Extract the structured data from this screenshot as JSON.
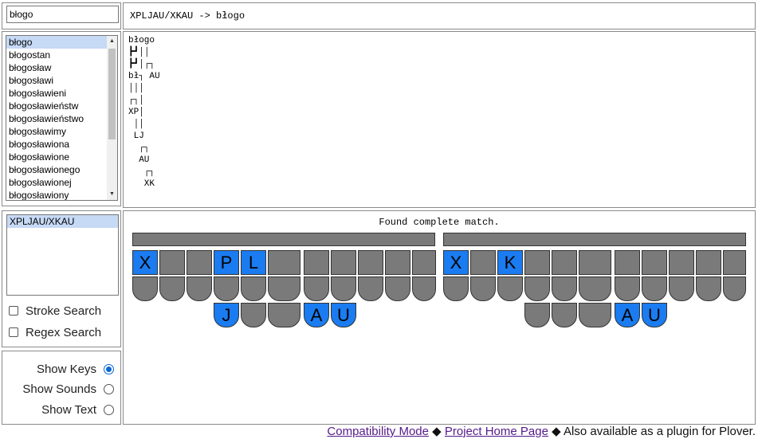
{
  "search": {
    "value": "błogo"
  },
  "word_list": {
    "selected_index": 0,
    "items": [
      "błogo",
      "błogostan",
      "błogosław",
      "błogosławi",
      "błogosławieni",
      "błogosławieństw",
      "błogosławieństwo",
      "błogosławimy",
      "błogosławiona",
      "błogosławione",
      "błogosławionego",
      "błogosławionej",
      "błogosławiony"
    ]
  },
  "header": {
    "text": "XPLJAU/XKAU -> błogo"
  },
  "tree": {
    "text": "błogo\n┣┛││\n┣┛│┌┐\nbł┐ AU\n│││\n┌┐│\nXP│\n ││\n LJ\n  ┌┐\n  AU\n   ┌┐\n   XK"
  },
  "strokes": {
    "items": [
      "XPLJAU/XKAU"
    ],
    "selected_index": 0
  },
  "search_options": {
    "stroke_search": "Stroke Search",
    "regex_search": "Regex Search"
  },
  "display_options": {
    "show_keys": "Show Keys",
    "show_sounds": "Show Sounds",
    "show_text": "Show Text",
    "selected": "show_keys"
  },
  "status": {
    "text": "Found complete match."
  },
  "keyboards": [
    {
      "top_keys": [
        "X",
        "",
        "",
        "P",
        "L",
        "",
        "",
        "",
        "",
        "",
        ""
      ],
      "top_active": [
        0,
        3,
        4
      ],
      "bottom_labels": [
        "J",
        "",
        "",
        "A",
        "U"
      ],
      "bottom_active": [
        0,
        3,
        4
      ]
    },
    {
      "top_keys": [
        "X",
        "",
        "K",
        "",
        "",
        "",
        "",
        "",
        "",
        "",
        "",
        ""
      ],
      "top_active": [
        0,
        2
      ],
      "bottom_labels": [
        "",
        "",
        "",
        "A",
        "U"
      ],
      "bottom_active": [
        3,
        4
      ]
    }
  ],
  "footer": {
    "compat": "Compatibility Mode",
    "sep1": "◆",
    "home": "Project Home Page",
    "sep2": "◆",
    "plugin": "Also available as a plugin for Plover."
  },
  "colors": {
    "active_key": "#1a7cf0",
    "inactive_key": "#7a7a7a",
    "selection": "#c6d9f5"
  }
}
